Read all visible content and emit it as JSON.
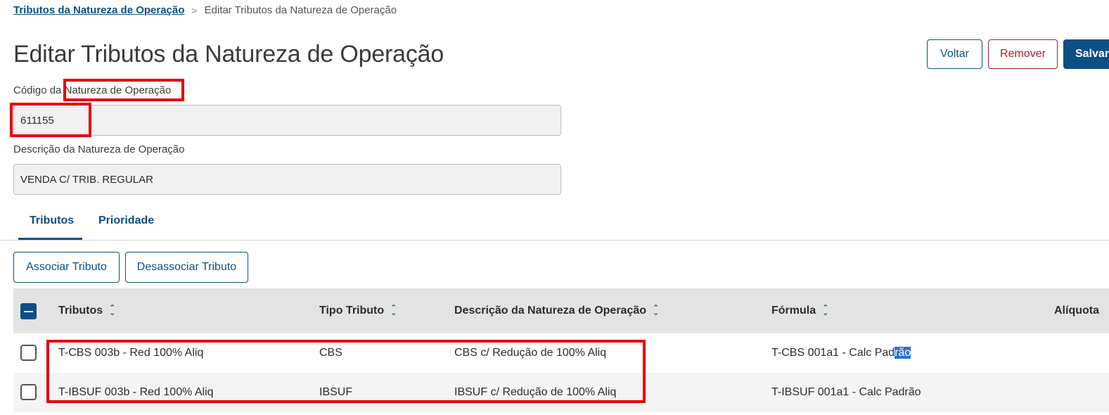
{
  "breadcrumb": {
    "parent": "Tributos da Natureza de Operação",
    "separator": ">",
    "current": "Editar Tributos da Natureza de Operação"
  },
  "title": "Editar Tributos da Natureza de Operação",
  "actions": {
    "back": "Voltar",
    "remove": "Remover",
    "save": "Salvar"
  },
  "fields": {
    "code_label_prefix": "Código da",
    "code_label_suffix": "Natureza de Operação",
    "code_value": "611155",
    "desc_label": "Descrição da Natureza de Operação",
    "desc_value": "VENDA C/ TRIB. REGULAR"
  },
  "tabs": [
    {
      "label": "Tributos",
      "active": true
    },
    {
      "label": "Prioridade",
      "active": false
    }
  ],
  "table_actions": {
    "associate": "Associar Tributo",
    "disassociate": "Desassociar Tributo"
  },
  "table": {
    "columns": [
      "Tributos",
      "Tipo Tributo",
      "Descrição da Natureza de Operação",
      "Fórmula",
      "Alíquota"
    ],
    "rows": [
      {
        "tributo": "T-CBS 003b - Red 100% Aliq",
        "tipo": "CBS",
        "descricao": "CBS c/ Redução de 100% Aliq",
        "formula_a": "T-CBS 001a1 - Calc Pad",
        "formula_b": "rão",
        "aliquota": ""
      },
      {
        "tributo": "T-IBSUF 003b - Red 100% Aliq",
        "tipo": "IBSUF",
        "descricao": "IBSUF c/ Redução de 100% Aliq",
        "formula": "T-IBSUF 001a1 - Calc Padrão",
        "aliquota": ""
      }
    ]
  },
  "icons": {
    "sort": "sort-icon",
    "separator": "chevron-right-icon"
  },
  "colors": {
    "primary": "#0c4f84",
    "danger": "#a3212a",
    "highlight": "#e8000b",
    "selection": "#2f6fd6"
  }
}
